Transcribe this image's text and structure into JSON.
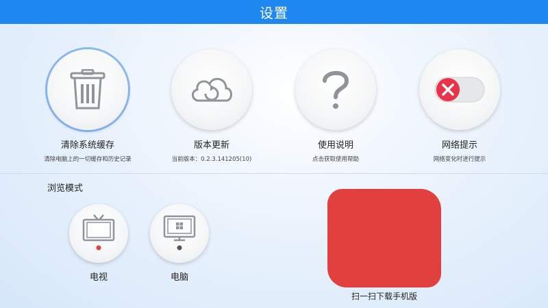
{
  "header": {
    "title": "设置"
  },
  "settings": [
    {
      "label": "清除系统缓存",
      "sub": "清除电脑上的一切缓存和历史记录",
      "icon": "trash-icon"
    },
    {
      "label": "版本更新",
      "sub": "当前版本：0.2.3.141205(10)",
      "icon": "cloud-refresh-icon"
    },
    {
      "label": "使用说明",
      "sub": "点击获取使用帮助",
      "icon": "question-icon"
    },
    {
      "label": "网络提示",
      "sub": "网络变化时进行提示",
      "icon": "toggle-off-icon"
    }
  ],
  "browse": {
    "title": "浏览模式",
    "modes": [
      {
        "label": "电视",
        "icon": "tv-icon",
        "selected": true
      },
      {
        "label": "电脑",
        "icon": "computer-icon",
        "selected": false
      }
    ]
  },
  "qr": {
    "caption": "扫一扫下载手机版"
  },
  "colors": {
    "header": "#1e88f0",
    "accent_red": "#e23f3f",
    "toggle_red": "#e8334a"
  }
}
